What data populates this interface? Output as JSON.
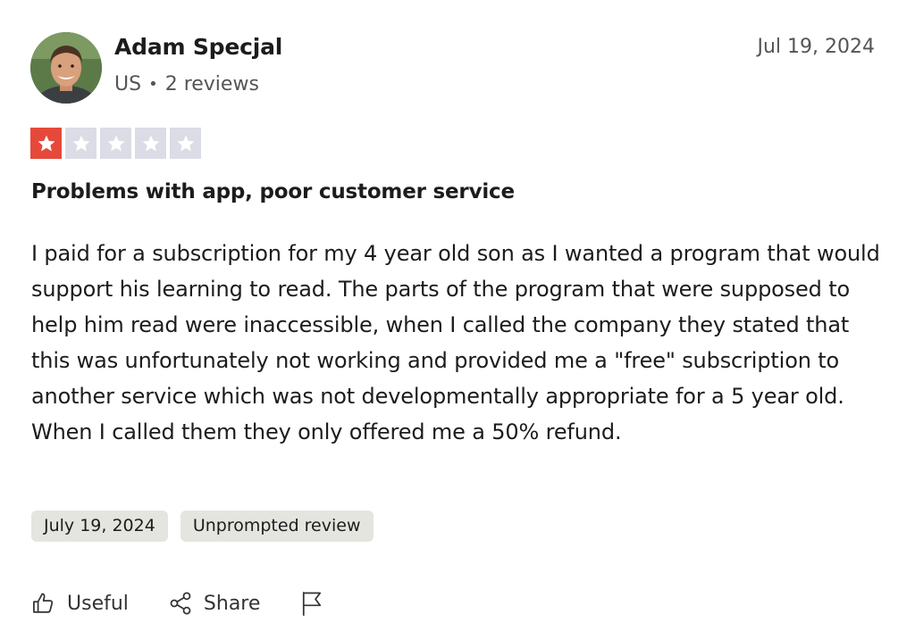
{
  "reviewer": {
    "name": "Adam Specjal",
    "country": "US",
    "separator": "•",
    "reviews_count": "2 reviews"
  },
  "review": {
    "date": "Jul 19, 2024",
    "rating": 1,
    "max_rating": 5,
    "rating_colors": {
      "filled": "#e5493a",
      "empty": "#dcdce6"
    },
    "title": "Problems with app, poor customer service",
    "body": "I paid for a subscription for my 4 year old son as I wanted a program that would support his learning to read. The parts of the program that were supposed to help him read were inaccessible, when I called the company they stated that this was unfortunately not working and provided me a \"free\" subscription to another service which was not developmentally appropriate for a 5 year old. When I called them they only offered me a 50% refund."
  },
  "tags": {
    "experience_date": "July 19, 2024",
    "review_type": "Unprompted review"
  },
  "actions": {
    "useful_label": "Useful",
    "share_label": "Share"
  },
  "icons": {
    "useful": "thumbs-up-icon",
    "share": "share-icon",
    "report": "flag-icon",
    "star": "star-icon"
  }
}
